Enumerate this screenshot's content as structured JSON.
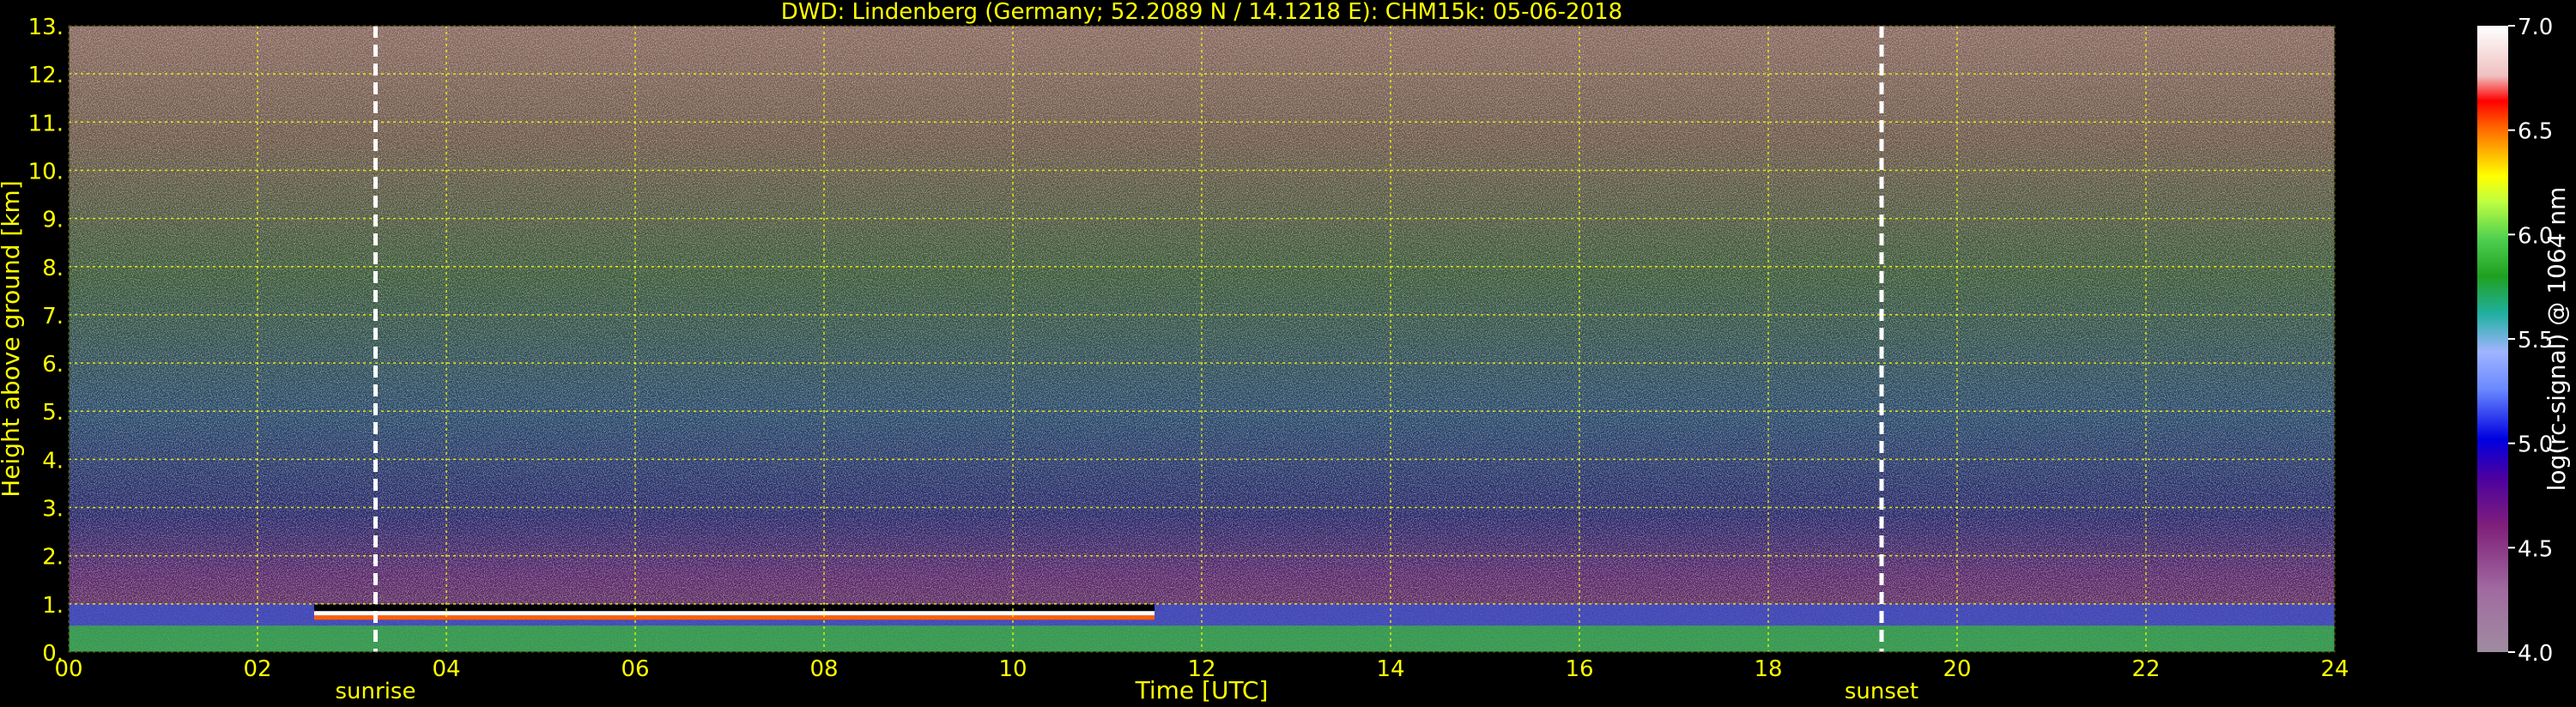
{
  "chart_data": {
    "type": "heatmap",
    "title": "DWD: Lindenberg (Germany; 52.2089 N / 14.1218 E):    CHM15k: 05-06-2018",
    "xlabel": "Time [UTC]",
    "ylabel": "Height above ground [km]",
    "xlim": [
      0,
      24
    ],
    "ylim": [
      0,
      13
    ],
    "x_ticks": [
      "00",
      "02",
      "04",
      "06",
      "08",
      "10",
      "12",
      "14",
      "16",
      "18",
      "20",
      "22",
      "24"
    ],
    "y_ticks": [
      "0.",
      "1.",
      "2.",
      "3.",
      "4.",
      "5.",
      "6.",
      "7.",
      "8.",
      "9.",
      "10.",
      "11.",
      "12.",
      "13."
    ],
    "grid": true,
    "annotations": [
      {
        "text": "sunrise",
        "x": 3.25
      },
      {
        "text": "sunset",
        "x": 19.2
      }
    ],
    "colorbar": {
      "label": "log(rc-signal) @ 1064 nm",
      "range": [
        4.0,
        7.0
      ],
      "ticks": [
        "4.0",
        "4.5",
        "5.0",
        "5.5",
        "6.0",
        "6.5",
        "7.0"
      ]
    },
    "layers": [
      {
        "feature": "boundary layer aerosol",
        "time_start": 0,
        "time_end": 24,
        "height_top_km": 1.0
      },
      {
        "feature": "cloud layer",
        "time_start": 2.6,
        "time_end": 11.5,
        "height_km": 0.85
      }
    ]
  },
  "colors": {
    "background": "#000000",
    "axis_text": "#ffff00",
    "grid": "#ffff00",
    "colorbar_text": "#ffffff",
    "annotation_line": "#ffffff"
  }
}
